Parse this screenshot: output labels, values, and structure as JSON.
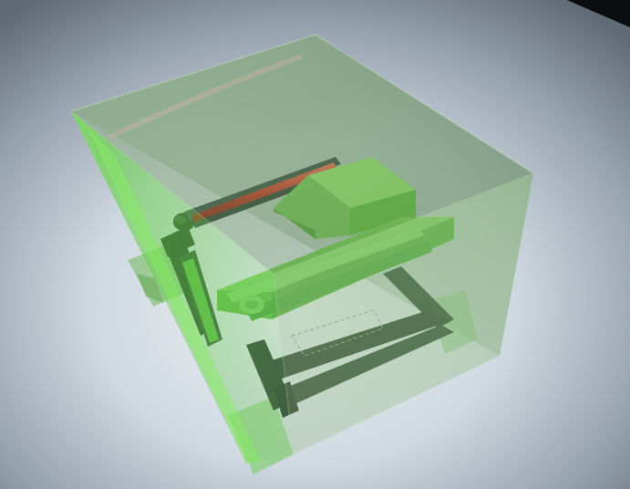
{
  "scene": {
    "kind": "3d-viewport",
    "subject": "transparent-green-enclosure-with-linear-stage",
    "colors": {
      "background_light": "#eef2f6",
      "background_mid": "#b9c4cf",
      "background_dark": "#5f6a75",
      "enclosure_green": "#66d24a",
      "part_green": "#62c43e",
      "frame_dark": "#1f3a22",
      "rod_red": "#d02a20",
      "rod_dark": "#3a4a44"
    },
    "icons": [
      "vignette-corner-shadow"
    ]
  }
}
